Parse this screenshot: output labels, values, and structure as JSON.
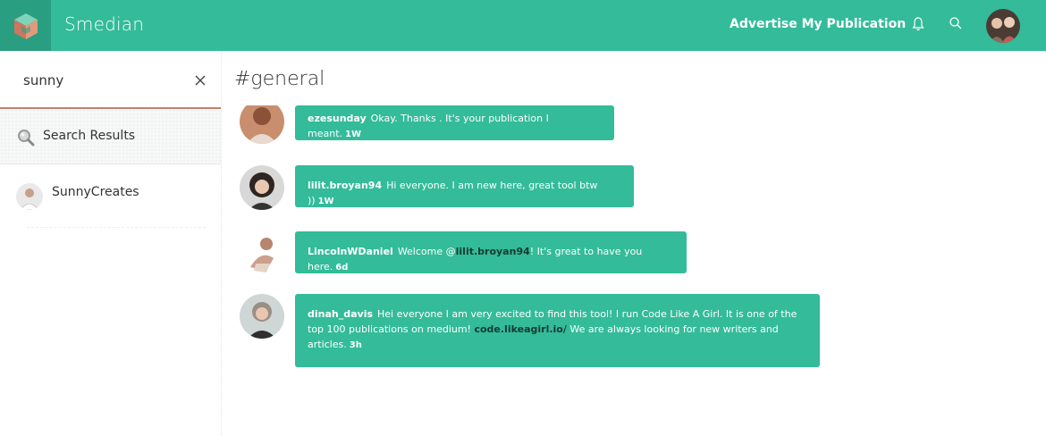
{
  "app": {
    "brand": "Smedian",
    "accent": "#33bb9a",
    "logo_bg": "#2a9e81"
  },
  "topbar": {
    "advertise_label": "Advertise My Publication",
    "icons": [
      "bell-icon",
      "search-icon"
    ]
  },
  "sidebar": {
    "search_value": "sunny",
    "results_label": "Search Results",
    "results": [
      {
        "name": "SunnyCreates"
      }
    ]
  },
  "channel": {
    "title": "#general"
  },
  "messages": [
    {
      "user": "ezesunday",
      "text": "Okay. Thanks . It's your publication I meant.",
      "time": "1W"
    },
    {
      "user": "lilit.broyan94",
      "text": "Hi everyone. I am new here, great tool btw ))",
      "time": "1W"
    },
    {
      "user": "LincolnWDaniel",
      "text_before": "Welcome @",
      "mention": "lilit.broyan94",
      "text_after": "! It's great to have you here.",
      "time": "6d"
    },
    {
      "user": "dinah_davis",
      "text_before": "Hei everyone I am very excited to find this tool! I run Code Like A Girl. It is one of the top 100 publications on medium!",
      "link": "code.likeagirl.io/",
      "text_after": "We are always looking for new writers and articles.",
      "time": "3h"
    }
  ]
}
